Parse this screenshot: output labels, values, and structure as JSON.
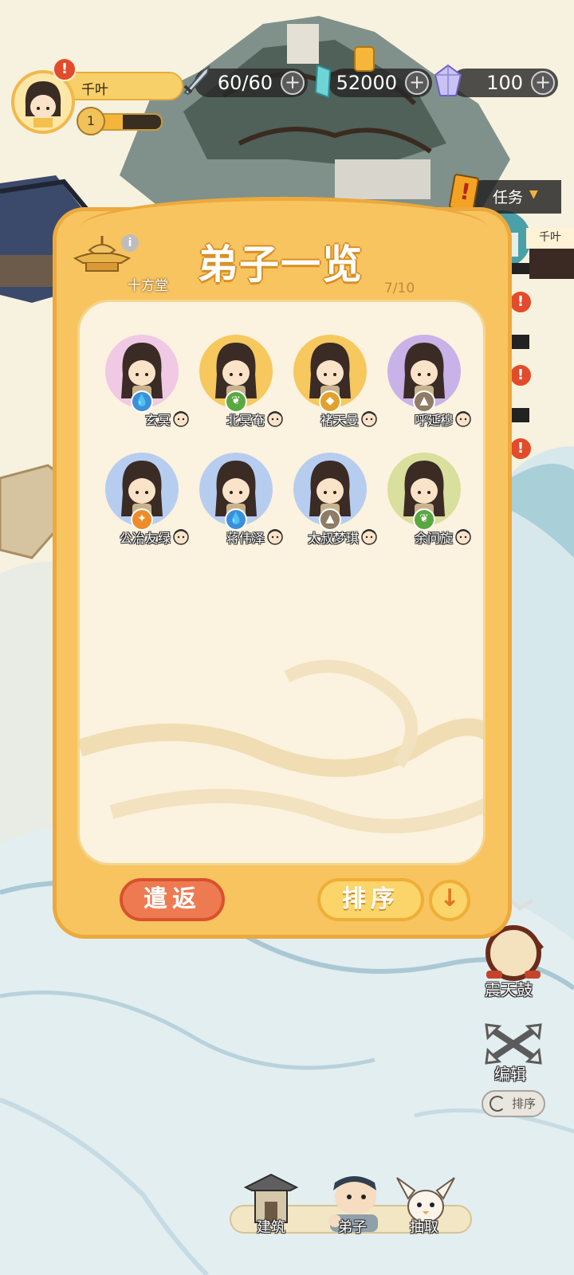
{
  "player": {
    "name": "千叶",
    "level": "1",
    "xp_fraction": 0.4
  },
  "resources": {
    "stamina": "60/60",
    "jade": "52000",
    "crystal": "100"
  },
  "quest": {
    "label": "任务"
  },
  "right_tag": {
    "label": "千叶"
  },
  "panel": {
    "hall_label": "十方堂",
    "info_symbol": "i",
    "title": "弟子一览",
    "count": "7/10",
    "dismiss_label": "遣返",
    "sort_label": "排序",
    "sort_direction_symbol": "↓"
  },
  "disciples": [
    {
      "name": "玄冥",
      "element": "water",
      "element_color": "#3c8fd8",
      "bg": "#f0c9e4"
    },
    {
      "name": "北冥奄",
      "element": "wood",
      "element_color": "#5aa840",
      "bg": "#f6c85d"
    },
    {
      "name": "褚天曼",
      "element": "metal",
      "element_color": "#e1a12b",
      "bg": "#f6c85d"
    },
    {
      "name": "呼延穆",
      "element": "earth",
      "element_color": "#8e7c66",
      "bg": "#c9b2e8"
    },
    {
      "name": "公冶友绿",
      "element": "fire",
      "element_color": "#ef8c2a",
      "bg": "#b7cdf0"
    },
    {
      "name": "蒋伟泽",
      "element": "water",
      "element_color": "#3c8fd8",
      "bg": "#b7cdf0"
    },
    {
      "name": "太叔梦琪",
      "element": "earth",
      "element_color": "#8e7c66",
      "bg": "#b7cdf0"
    },
    {
      "name": "余问旋",
      "element": "wood",
      "element_color": "#5aa840",
      "bg": "#d9df9c"
    }
  ],
  "side": {
    "drum_label": "震天鼓",
    "edit_label": "编辑",
    "sort_label": "排序"
  },
  "nav": {
    "build_label": "建筑",
    "disciple_label": "弟子",
    "draw_label": "抽取"
  },
  "colors": {
    "panel": "#f8c460",
    "panel_border": "#eca93e",
    "paper": "#fbf2df",
    "alert": "#e24b2b",
    "dismiss": "#ee7a52"
  }
}
